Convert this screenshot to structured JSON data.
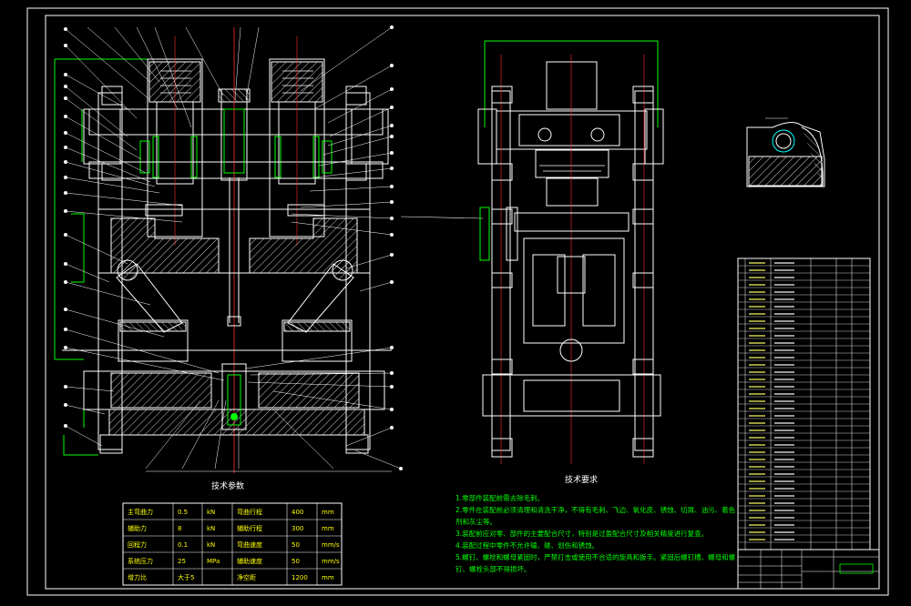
{
  "parameters_title": "技术参数",
  "requirements_title": "技术要求",
  "parameters_table": {
    "rows": [
      [
        "主弯曲力",
        "0.5",
        "kN",
        "弯曲行程",
        "400",
        "mm"
      ],
      [
        "辅助力",
        "8",
        "kN",
        "辅助行程",
        "300",
        "mm"
      ],
      [
        "回程力",
        "0.1",
        "kN",
        "弯曲速度",
        "50",
        "mm/s"
      ],
      [
        "系统压力",
        "25",
        "MPa",
        "辅助速度",
        "50",
        "mm/s"
      ],
      [
        "增力比",
        "大于5",
        "",
        "净空距",
        "1200",
        "mm"
      ]
    ]
  },
  "requirements": [
    "1.零部件装配前需去除毛刺。",
    "2.零件在装配前必须清理和清洗干净，不得有毛刺、飞边、氧化皮、锈蚀、切屑、油污、着色",
    "  剂和灰尘等。",
    "3.装配前应对零、部件的主要配合尺寸，特别是过盈配合尺寸及相关精度进行复查。",
    "4.装配过程中零件不允许磕、碰、划伤和锈蚀。",
    "5.螺钉、螺栓和螺母紧固时，严禁打击或使用不合适的旋具和扳手。紧固后螺钉槽、螺母和螺",
    "  钉、螺栓头部不得损坏。"
  ]
}
